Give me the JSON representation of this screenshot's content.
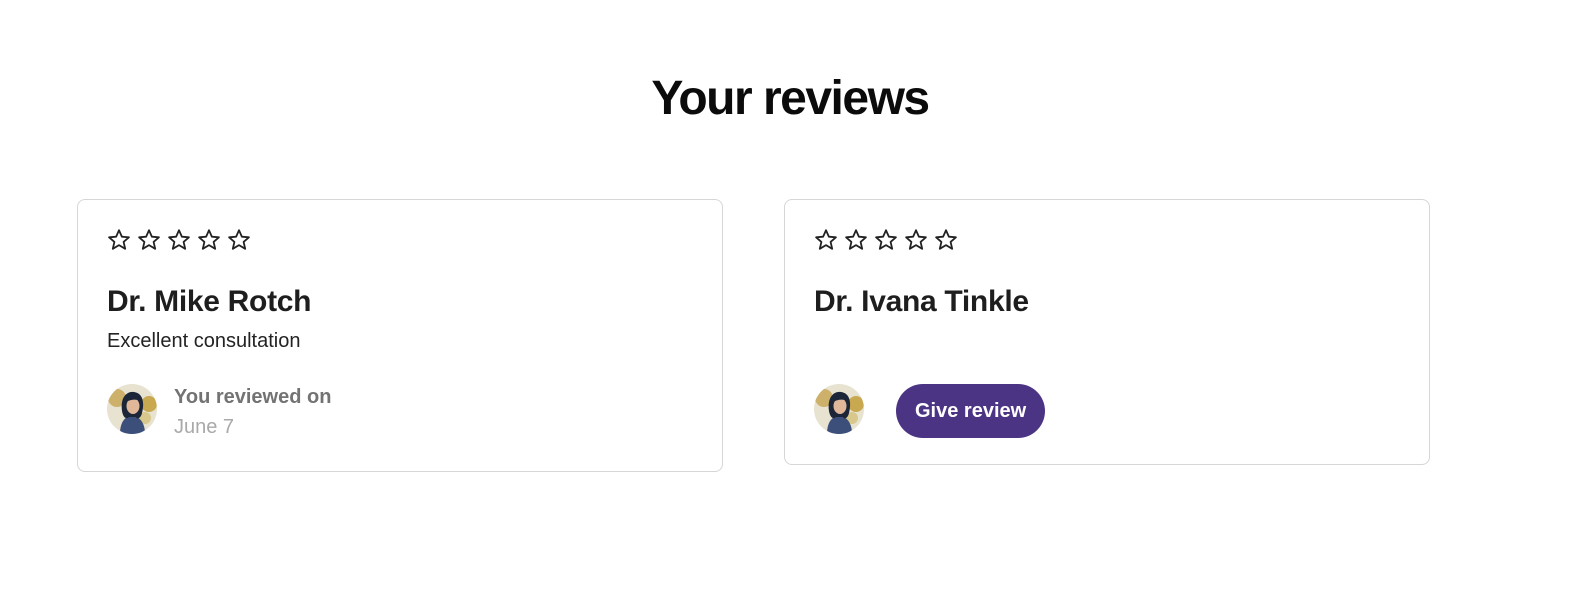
{
  "page": {
    "title": "Your reviews"
  },
  "reviews": [
    {
      "rating": 0,
      "max_rating": 5,
      "doctor_name": "Dr. Mike Rotch",
      "review_text": "Excellent consultation",
      "status_label": "You reviewed on",
      "status_date": "June 7"
    },
    {
      "rating": 0,
      "max_rating": 5,
      "doctor_name": "Dr. Ivana Tinkle",
      "review_text": "",
      "action_label": "Give review"
    }
  ],
  "icons": {
    "star": "star-outline-icon",
    "avatar": "user-avatar"
  },
  "colors": {
    "accent": "#4b3484",
    "card_border": "#d6d6d6",
    "star_stroke": "#222222",
    "muted_text": "#737373",
    "date_text": "#a9a9a9"
  }
}
